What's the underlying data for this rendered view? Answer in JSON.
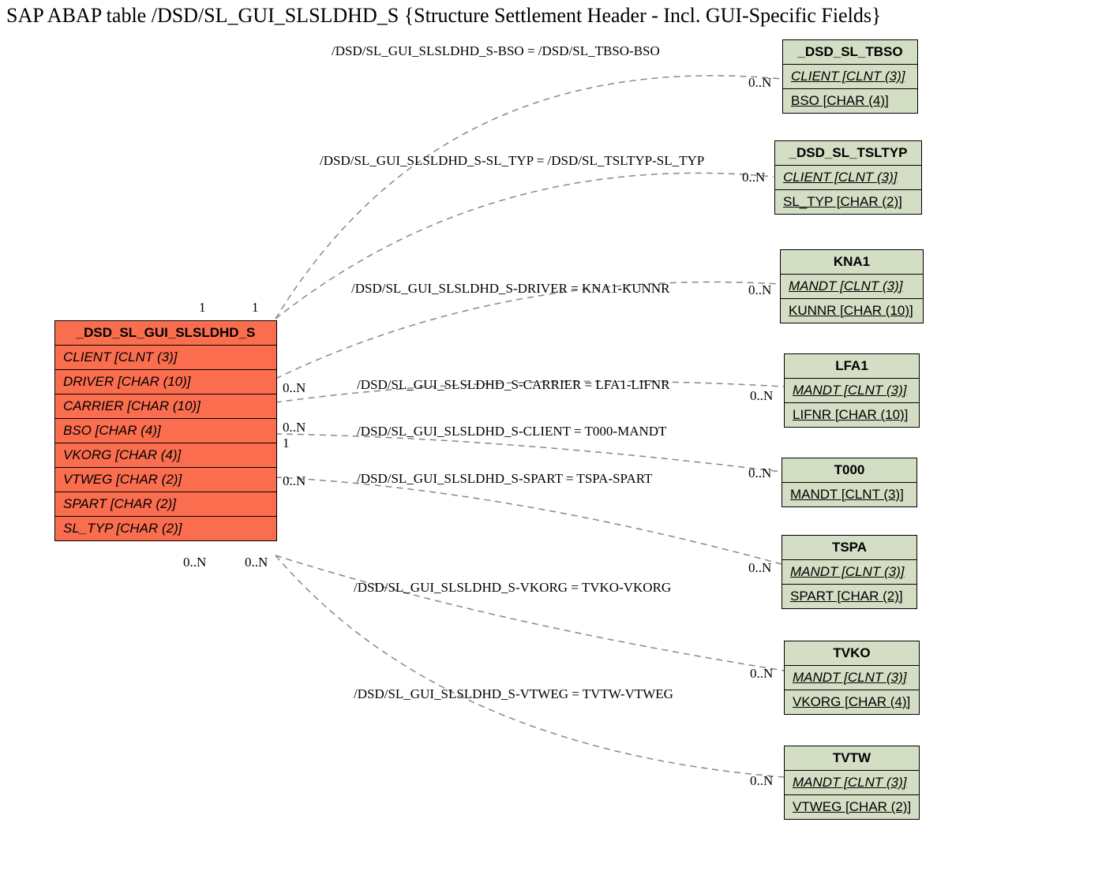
{
  "title": "SAP ABAP table /DSD/SL_GUI_SLSLDHD_S {Structure Settlement Header - Incl. GUI-Specific Fields}",
  "main_entity": {
    "name": "_DSD_SL_GUI_SLSLDHD_S",
    "fields": [
      {
        "text": "CLIENT [CLNT (3)]",
        "italic": true
      },
      {
        "text": "DRIVER [CHAR (10)]",
        "italic": true
      },
      {
        "text": "CARRIER [CHAR (10)]",
        "italic": true
      },
      {
        "text": "BSO [CHAR (4)]",
        "italic": true
      },
      {
        "text": "VKORG [CHAR (4)]",
        "italic": true
      },
      {
        "text": "VTWEG [CHAR (2)]",
        "italic": true
      },
      {
        "text": "SPART [CHAR (2)]",
        "italic": true
      },
      {
        "text": "SL_TYP [CHAR (2)]",
        "italic": true
      }
    ]
  },
  "ref_entities": [
    {
      "id": "tbso",
      "name": "_DSD_SL_TBSO",
      "fields": [
        {
          "text": "CLIENT [CLNT (3)]",
          "italic": true,
          "underline": true
        },
        {
          "text": "BSO [CHAR (4)]",
          "underline": true
        }
      ]
    },
    {
      "id": "tsltyp",
      "name": "_DSD_SL_TSLTYP",
      "fields": [
        {
          "text": "CLIENT [CLNT (3)]",
          "italic": true,
          "underline": true
        },
        {
          "text": "SL_TYP [CHAR (2)]",
          "underline": true
        }
      ]
    },
    {
      "id": "kna1",
      "name": "KNA1",
      "fields": [
        {
          "text": "MANDT [CLNT (3)]",
          "italic": true,
          "underline": true
        },
        {
          "text": "KUNNR [CHAR (10)]",
          "underline": true
        }
      ]
    },
    {
      "id": "lfa1",
      "name": "LFA1",
      "fields": [
        {
          "text": "MANDT [CLNT (3)]",
          "italic": true,
          "underline": true
        },
        {
          "text": "LIFNR [CHAR (10)]",
          "underline": true
        }
      ]
    },
    {
      "id": "t000",
      "name": "T000",
      "fields": [
        {
          "text": "MANDT [CLNT (3)]",
          "underline": true
        }
      ]
    },
    {
      "id": "tspa",
      "name": "TSPA",
      "fields": [
        {
          "text": "MANDT [CLNT (3)]",
          "italic": true,
          "underline": true
        },
        {
          "text": "SPART [CHAR (2)]",
          "underline": true
        }
      ]
    },
    {
      "id": "tvko",
      "name": "TVKO",
      "fields": [
        {
          "text": "MANDT [CLNT (3)]",
          "italic": true,
          "underline": true
        },
        {
          "text": "VKORG [CHAR (4)]",
          "underline": true
        }
      ]
    },
    {
      "id": "tvtw",
      "name": "TVTW",
      "fields": [
        {
          "text": "MANDT [CLNT (3)]",
          "italic": true,
          "underline": true
        },
        {
          "text": "VTWEG [CHAR (2)]",
          "underline": true
        }
      ]
    }
  ],
  "relationships": [
    {
      "label": "/DSD/SL_GUI_SLSLDHD_S-BSO = /DSD/SL_TBSO-BSO",
      "left_card": "1",
      "right_card": "0..N"
    },
    {
      "label": "/DSD/SL_GUI_SLSLDHD_S-SL_TYP = /DSD/SL_TSLTYP-SL_TYP",
      "left_card": "1",
      "right_card": "0..N"
    },
    {
      "label": "/DSD/SL_GUI_SLSLDHD_S-DRIVER = KNA1-KUNNR",
      "left_card": "0..N",
      "right_card": "0..N"
    },
    {
      "label": "/DSD/SL_GUI_SLSLDHD_S-CARRIER = LFA1-LIFNR",
      "left_card": "0..N",
      "right_card": "0..N"
    },
    {
      "label": "/DSD/SL_GUI_SLSLDHD_S-CLIENT = T000-MANDT",
      "left_card": "1",
      "right_card": "0..N"
    },
    {
      "label": "/DSD/SL_GUI_SLSLDHD_S-SPART = TSPA-SPART",
      "left_card": "0..N",
      "right_card": "0..N"
    },
    {
      "label": "/DSD/SL_GUI_SLSLDHD_S-VKORG = TVKO-VKORG",
      "left_card": "0..N",
      "right_card": "0..N"
    },
    {
      "label": "/DSD/SL_GUI_SLSLDHD_S-VTWEG = TVTW-VTWEG",
      "left_card": "0..N",
      "right_card": "0..N"
    }
  ]
}
